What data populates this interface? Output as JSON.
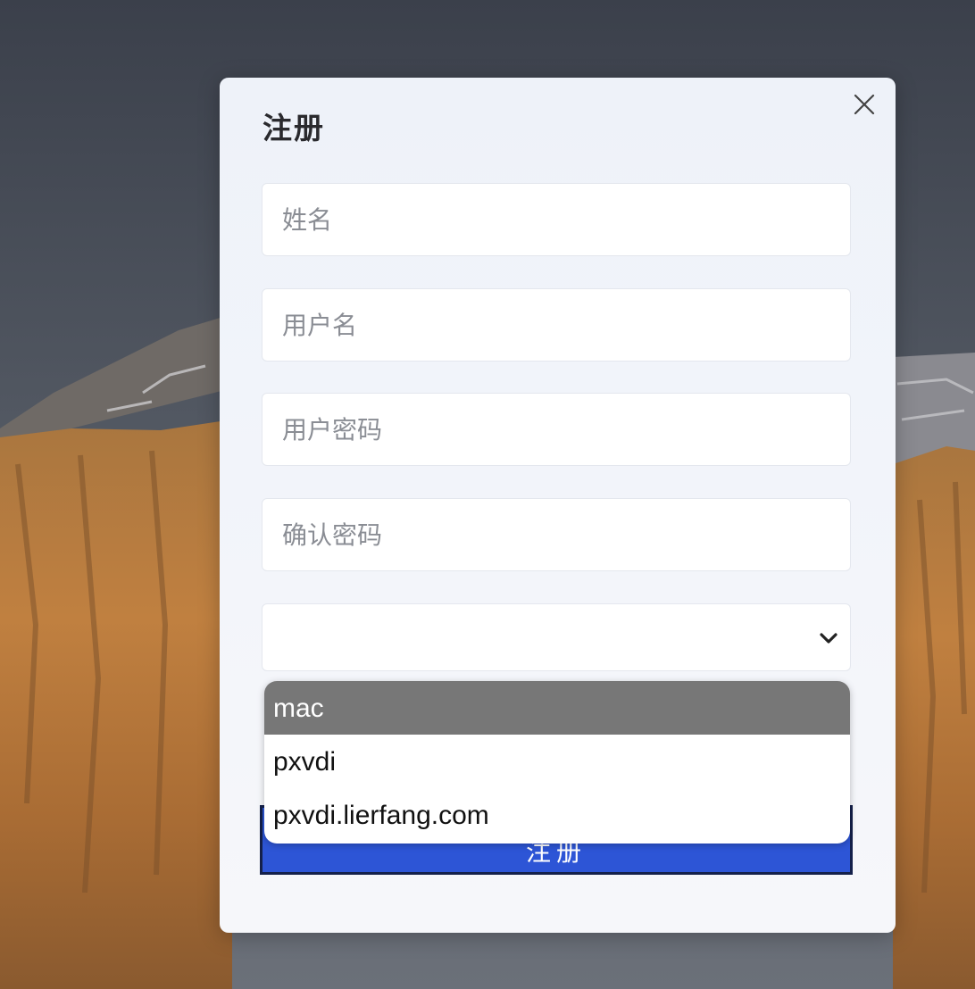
{
  "dialog": {
    "title": "注册",
    "close_icon": "close-icon"
  },
  "form": {
    "name_placeholder": "姓名",
    "username_placeholder": "用户名",
    "password_placeholder": "用户密码",
    "confirm_password_placeholder": "确认密码",
    "domain_select": {
      "value": "",
      "icon": "chevron-down-icon",
      "options": [
        "mac",
        "pxvdi",
        "pxvdi.lierfang.com"
      ],
      "highlighted_option": "mac"
    },
    "submit_label": "注册"
  },
  "colors": {
    "accent": "#2d55d6",
    "option_highlight": "#777777"
  }
}
